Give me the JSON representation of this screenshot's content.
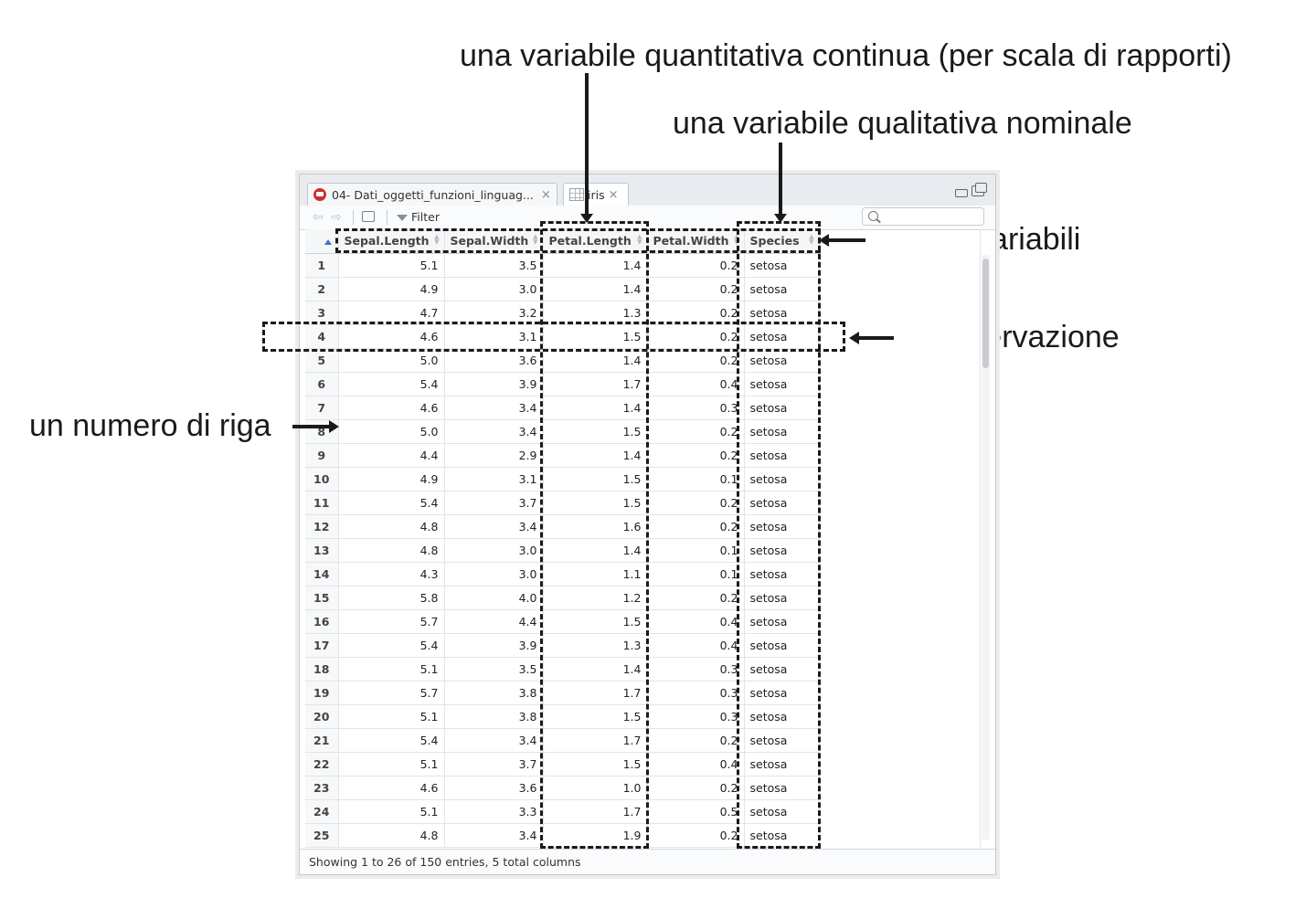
{
  "annotations": {
    "top_label": "una variabile quantitativa continua (per scala di rapporti)",
    "nominal_label": "una variabile qualitativa nominale",
    "names_label": "nomi di variabili",
    "observation_label": "un’osservazione",
    "row_number_label": "un numero di riga"
  },
  "window": {
    "tabs": [
      {
        "label": "04- Dati_oggetti_funzioni_linguag...",
        "icon": "r-file-icon"
      },
      {
        "label": "iris",
        "icon": "data-grid-icon"
      }
    ],
    "close_glyph": "×"
  },
  "toolbar": {
    "filter_label": "Filter",
    "search_placeholder": ""
  },
  "table": {
    "columns": [
      "Sepal.Length",
      "Sepal.Width",
      "Petal.Length",
      "Petal.Width",
      "Species"
    ],
    "rows": [
      {
        "n": "1",
        "sl": "5.1",
        "sw": "3.5",
        "pl": "1.4",
        "pw": "0.2",
        "sp": "setosa"
      },
      {
        "n": "2",
        "sl": "4.9",
        "sw": "3.0",
        "pl": "1.4",
        "pw": "0.2",
        "sp": "setosa"
      },
      {
        "n": "3",
        "sl": "4.7",
        "sw": "3.2",
        "pl": "1.3",
        "pw": "0.2",
        "sp": "setosa"
      },
      {
        "n": "4",
        "sl": "4.6",
        "sw": "3.1",
        "pl": "1.5",
        "pw": "0.2",
        "sp": "setosa"
      },
      {
        "n": "5",
        "sl": "5.0",
        "sw": "3.6",
        "pl": "1.4",
        "pw": "0.2",
        "sp": "setosa"
      },
      {
        "n": "6",
        "sl": "5.4",
        "sw": "3.9",
        "pl": "1.7",
        "pw": "0.4",
        "sp": "setosa"
      },
      {
        "n": "7",
        "sl": "4.6",
        "sw": "3.4",
        "pl": "1.4",
        "pw": "0.3",
        "sp": "setosa"
      },
      {
        "n": "8",
        "sl": "5.0",
        "sw": "3.4",
        "pl": "1.5",
        "pw": "0.2",
        "sp": "setosa"
      },
      {
        "n": "9",
        "sl": "4.4",
        "sw": "2.9",
        "pl": "1.4",
        "pw": "0.2",
        "sp": "setosa"
      },
      {
        "n": "10",
        "sl": "4.9",
        "sw": "3.1",
        "pl": "1.5",
        "pw": "0.1",
        "sp": "setosa"
      },
      {
        "n": "11",
        "sl": "5.4",
        "sw": "3.7",
        "pl": "1.5",
        "pw": "0.2",
        "sp": "setosa"
      },
      {
        "n": "12",
        "sl": "4.8",
        "sw": "3.4",
        "pl": "1.6",
        "pw": "0.2",
        "sp": "setosa"
      },
      {
        "n": "13",
        "sl": "4.8",
        "sw": "3.0",
        "pl": "1.4",
        "pw": "0.1",
        "sp": "setosa"
      },
      {
        "n": "14",
        "sl": "4.3",
        "sw": "3.0",
        "pl": "1.1",
        "pw": "0.1",
        "sp": "setosa"
      },
      {
        "n": "15",
        "sl": "5.8",
        "sw": "4.0",
        "pl": "1.2",
        "pw": "0.2",
        "sp": "setosa"
      },
      {
        "n": "16",
        "sl": "5.7",
        "sw": "4.4",
        "pl": "1.5",
        "pw": "0.4",
        "sp": "setosa"
      },
      {
        "n": "17",
        "sl": "5.4",
        "sw": "3.9",
        "pl": "1.3",
        "pw": "0.4",
        "sp": "setosa"
      },
      {
        "n": "18",
        "sl": "5.1",
        "sw": "3.5",
        "pl": "1.4",
        "pw": "0.3",
        "sp": "setosa"
      },
      {
        "n": "19",
        "sl": "5.7",
        "sw": "3.8",
        "pl": "1.7",
        "pw": "0.3",
        "sp": "setosa"
      },
      {
        "n": "20",
        "sl": "5.1",
        "sw": "3.8",
        "pl": "1.5",
        "pw": "0.3",
        "sp": "setosa"
      },
      {
        "n": "21",
        "sl": "5.4",
        "sw": "3.4",
        "pl": "1.7",
        "pw": "0.2",
        "sp": "setosa"
      },
      {
        "n": "22",
        "sl": "5.1",
        "sw": "3.7",
        "pl": "1.5",
        "pw": "0.4",
        "sp": "setosa"
      },
      {
        "n": "23",
        "sl": "4.6",
        "sw": "3.6",
        "pl": "1.0",
        "pw": "0.2",
        "sp": "setosa"
      },
      {
        "n": "24",
        "sl": "5.1",
        "sw": "3.3",
        "pl": "1.7",
        "pw": "0.5",
        "sp": "setosa"
      },
      {
        "n": "25",
        "sl": "4.8",
        "sw": "3.4",
        "pl": "1.9",
        "pw": "0.2",
        "sp": "setosa"
      }
    ]
  },
  "status": {
    "text": "Showing 1 to 26 of 150 entries, 5 total columns"
  }
}
